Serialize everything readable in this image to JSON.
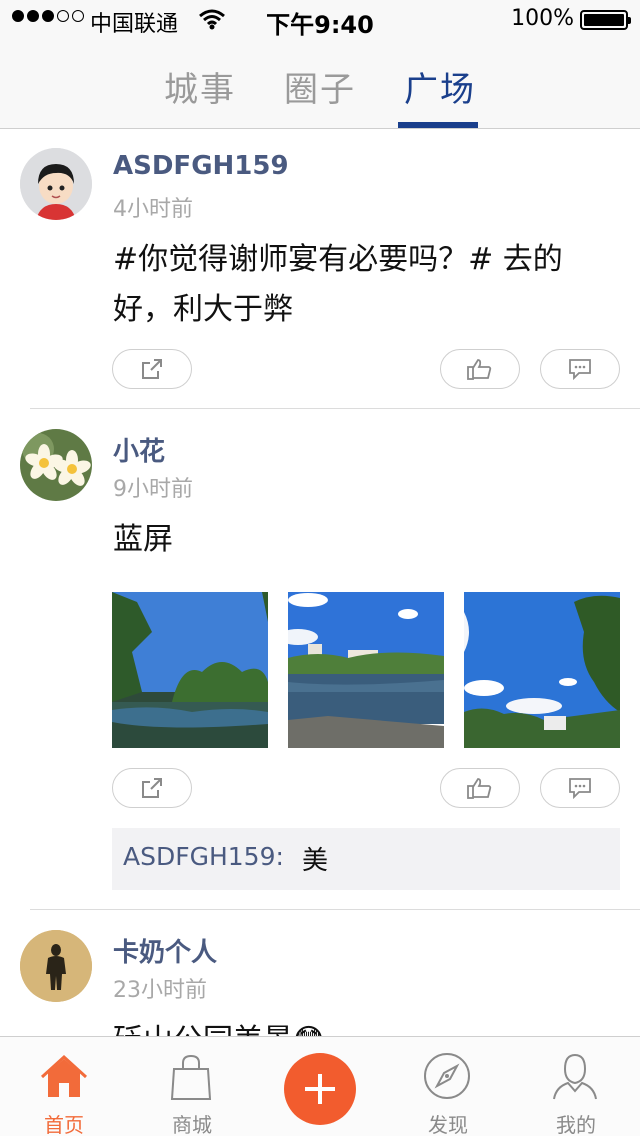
{
  "status_bar": {
    "carrier": "中国联通",
    "time": "下午9:40",
    "battery": "100%",
    "signal_bars": 3,
    "signal_total": 5
  },
  "top_tabs": [
    {
      "label": "城事",
      "active": false
    },
    {
      "label": "圈子",
      "active": false
    },
    {
      "label": "广场",
      "active": true
    }
  ],
  "posts": [
    {
      "username": "ASDFGH159",
      "time": "4小时前",
      "content": "#你觉得谢师宴有必要吗？# 去的好，利大于弊"
    },
    {
      "username": "小花",
      "time": "9小时前",
      "content": "蓝屏",
      "comment": {
        "user": "ASDFGH159:",
        "text": "美"
      }
    },
    {
      "username": "卡奶个人",
      "time": "23小时前",
      "content": "砭山公园美景😳"
    }
  ],
  "bottom_nav": [
    {
      "label": "首页",
      "icon": "home-icon",
      "active": true
    },
    {
      "label": "商城",
      "icon": "shopping-bag-icon",
      "active": false
    },
    {
      "label": "",
      "icon": "plus-icon",
      "active": false
    },
    {
      "label": "发现",
      "icon": "compass-icon",
      "active": false
    },
    {
      "label": "我的",
      "icon": "user-icon",
      "active": false
    }
  ],
  "colors": {
    "accent_blue": "#1a3f8c",
    "username": "#4a5a80",
    "brand_orange": "#f25c2e"
  }
}
